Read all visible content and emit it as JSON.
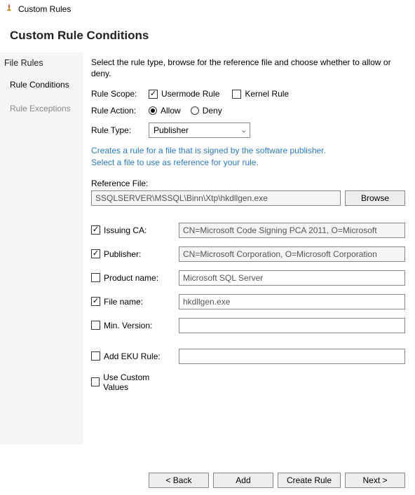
{
  "window": {
    "title": "Custom Rules"
  },
  "page": {
    "title": "Custom Rule Conditions"
  },
  "sidebar": {
    "heading": "File Rules",
    "items": [
      {
        "label": "Rule Conditions",
        "active": true
      },
      {
        "label": "Rule Exceptions",
        "active": false
      }
    ]
  },
  "intro": "Select the rule type, browse for the reference file and choose whether to allow or deny.",
  "scope": {
    "label": "Rule Scope:",
    "usermode": {
      "label": "Usermode Rule",
      "checked": true
    },
    "kernel": {
      "label": "Kernel Rule",
      "checked": false
    }
  },
  "action": {
    "label": "Rule Action:",
    "allow": {
      "label": "Allow",
      "selected": true
    },
    "deny": {
      "label": "Deny",
      "selected": false
    }
  },
  "type": {
    "label": "Rule Type:",
    "value": "Publisher",
    "hint1": "Creates a rule for a file that is signed by the software publisher.",
    "hint2": "Select a file to use as reference for your rule."
  },
  "ref": {
    "label": "Reference File:",
    "value": "SSQLSERVER\\MSSQL\\Binn\\Xtp\\hkdllgen.exe",
    "browse": "Browse"
  },
  "criteria": {
    "issuing_ca": {
      "label": "Issuing CA:",
      "checked": true,
      "value": "CN=Microsoft Code Signing PCA 2011, O=Microsoft"
    },
    "publisher": {
      "label": "Publisher:",
      "checked": true,
      "value": "CN=Microsoft Corporation, O=Microsoft Corporation"
    },
    "product": {
      "label": "Product name:",
      "checked": false,
      "value": "Microsoft SQL Server"
    },
    "file_name": {
      "label": "File name:",
      "checked": true,
      "value": "hkdllgen.exe"
    },
    "min_version": {
      "label": "Min. Version:",
      "checked": false,
      "value": ""
    },
    "add_eku": {
      "label": "Add EKU Rule:",
      "checked": false,
      "value": ""
    },
    "custom": {
      "label": "Use Custom Values",
      "checked": false
    }
  },
  "footer": {
    "back": "< Back",
    "add": "Add",
    "create": "Create Rule",
    "next": "Next >"
  }
}
